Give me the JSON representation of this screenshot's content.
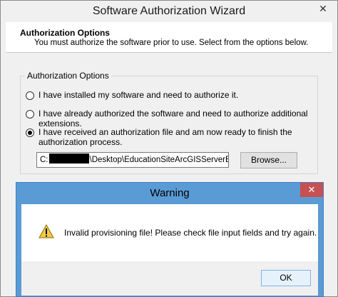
{
  "wizard": {
    "title": "Software Authorization Wizard",
    "close_label": "✕",
    "header": {
      "title": "Authorization Options",
      "subtitle": "You must authorize the software prior to use. Select from the options below."
    },
    "group_label": "Authorization Options",
    "options": [
      {
        "label": "I have installed my software and need to authorize it.",
        "checked": false
      },
      {
        "label": "I have already authorized the software and need to authorize additional extensions.",
        "checked": false
      },
      {
        "label": "I have received an authorization file and am now ready to finish the authorization process.",
        "checked": true
      }
    ],
    "path_prefix": "C:",
    "path_suffix": "\\Desktop\\EducationSiteArcGISServerEnterpris",
    "browse_label": "Browse..."
  },
  "warning": {
    "title": "Warning",
    "close_label": "✕",
    "message": "Invalid provisioning file!  Please check file input fields and try again.",
    "ok_label": "OK",
    "icon": "warning-icon"
  }
}
